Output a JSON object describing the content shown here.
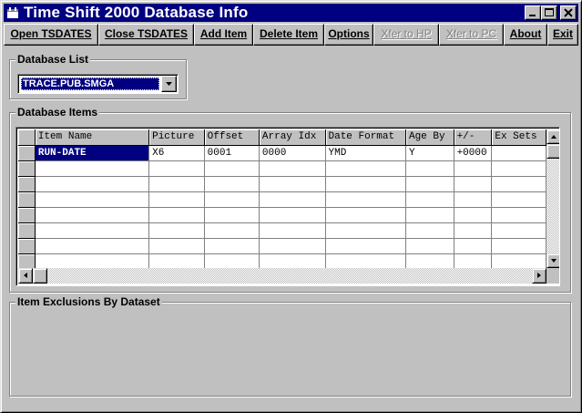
{
  "window": {
    "title": "Time Shift 2000 Database Info"
  },
  "toolbar": [
    {
      "label": "Open TSDATES",
      "enabled": true
    },
    {
      "label": "Close TSDATES",
      "enabled": true
    },
    {
      "label": "Add Item",
      "enabled": true
    },
    {
      "label": "Delete Item",
      "enabled": true
    },
    {
      "label": "Options",
      "enabled": true
    },
    {
      "label": "Xfer to HP",
      "enabled": false
    },
    {
      "label": "Xfer to PC",
      "enabled": false
    },
    {
      "label": "About",
      "enabled": true
    },
    {
      "label": "Exit",
      "enabled": true
    }
  ],
  "database_list": {
    "label": "Database List",
    "selected": "TRACE.PUB.SMGA"
  },
  "database_items": {
    "label": "Database Items",
    "columns": [
      "Item Name",
      "Picture",
      "Offset",
      "Array Idx",
      "Date Format",
      "Age By",
      "+/-",
      "Ex Sets"
    ],
    "rows": [
      [
        "RUN-DATE",
        "X6",
        "0001",
        "0000",
        "YMD",
        "Y",
        "+0000",
        ""
      ]
    ]
  },
  "exclusions": {
    "label": "Item Exclusions By Dataset"
  },
  "colors": {
    "title_bar": "#000080",
    "selection": "#000080",
    "face": "#c0c0c0"
  }
}
